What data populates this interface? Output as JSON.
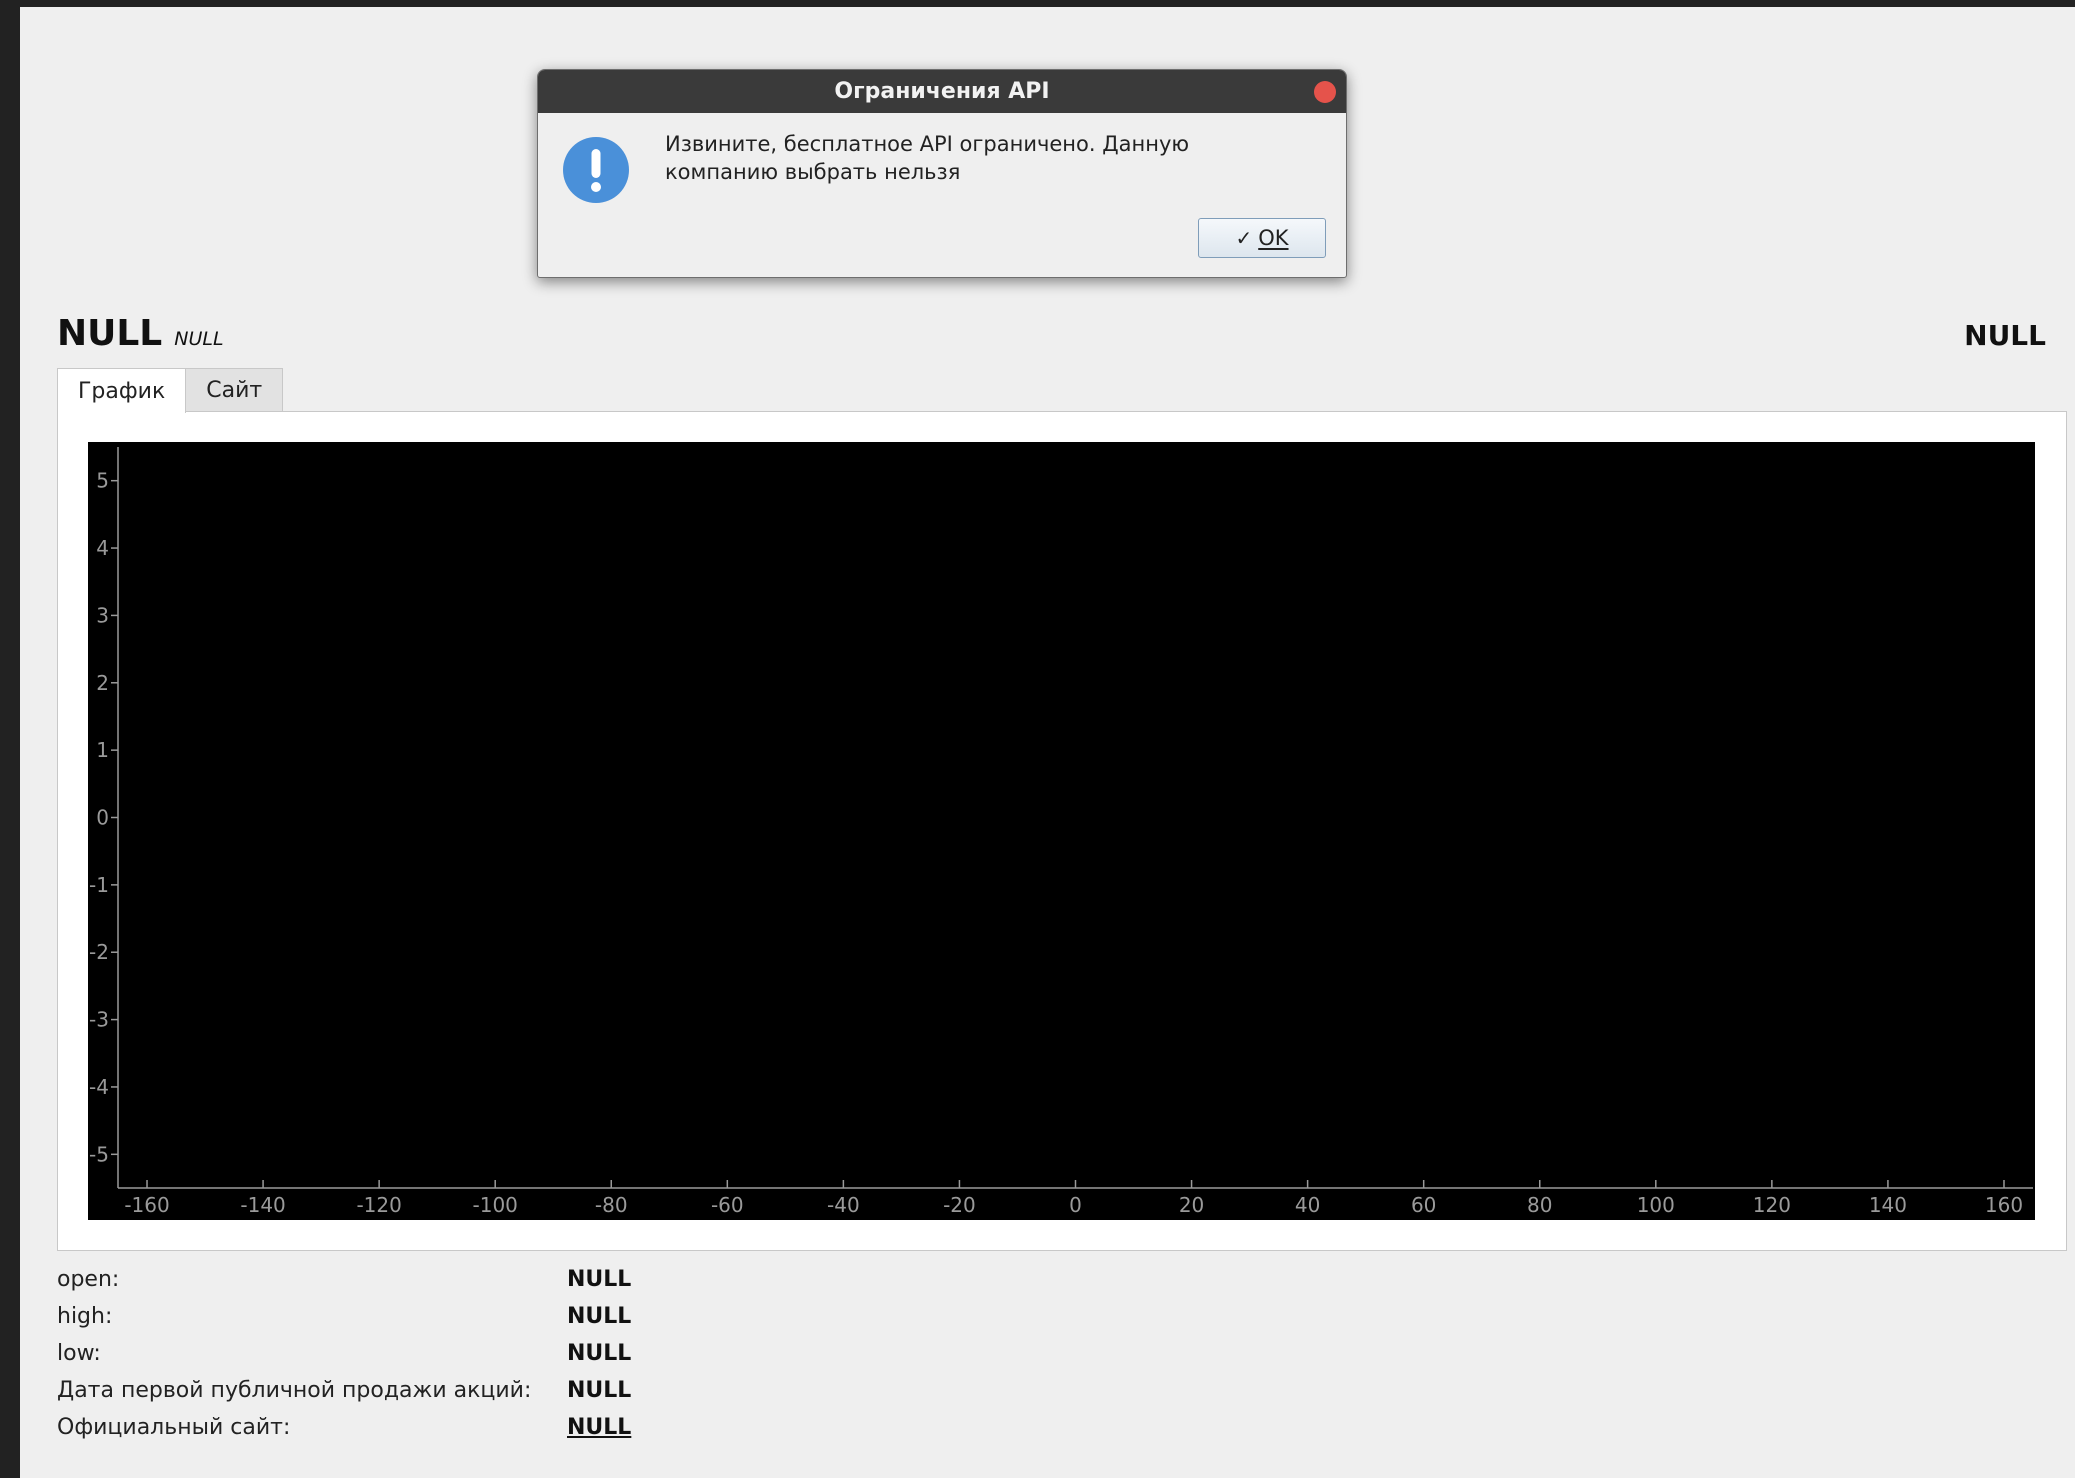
{
  "header": {
    "title": "NULL",
    "subtitle": "NULL",
    "right_value": "NULL"
  },
  "tabs": [
    {
      "label": "График",
      "active": true
    },
    {
      "label": "Сайт",
      "active": false
    }
  ],
  "chart_data": {
    "type": "line",
    "series": [],
    "x_ticks": [
      -160,
      -140,
      -120,
      -100,
      -80,
      -60,
      -40,
      -20,
      0,
      20,
      40,
      60,
      80,
      100,
      120,
      140,
      160
    ],
    "y_ticks": [
      5,
      4,
      3,
      2,
      1,
      0,
      -1,
      -2,
      -3,
      -4,
      -5
    ],
    "xlim": [
      -165,
      165
    ],
    "ylim": [
      -5.5,
      5.5
    ],
    "background": "#000000",
    "axis_color": "#9a9a9a",
    "grid": false
  },
  "info": [
    {
      "label": "open:",
      "value": "NULL",
      "link": false
    },
    {
      "label": "high:",
      "value": "NULL",
      "link": false
    },
    {
      "label": "low:",
      "value": "NULL",
      "link": false
    },
    {
      "label": "Дата первой публичной продажи акций:",
      "value": "NULL",
      "link": false
    },
    {
      "label": "Официальный сайт:",
      "value": "NULL",
      "link": true
    }
  ],
  "dialog": {
    "title": "Ограничения API",
    "message_line1": "Извините, бесплатное API ограничено. Данную",
    "message_line2": "компанию выбрать нельзя",
    "ok_check": "✓",
    "ok_label": "OK",
    "icon": "info-exclamation-icon",
    "icon_color": "#4a90d9",
    "close_color": "#e5534b"
  }
}
